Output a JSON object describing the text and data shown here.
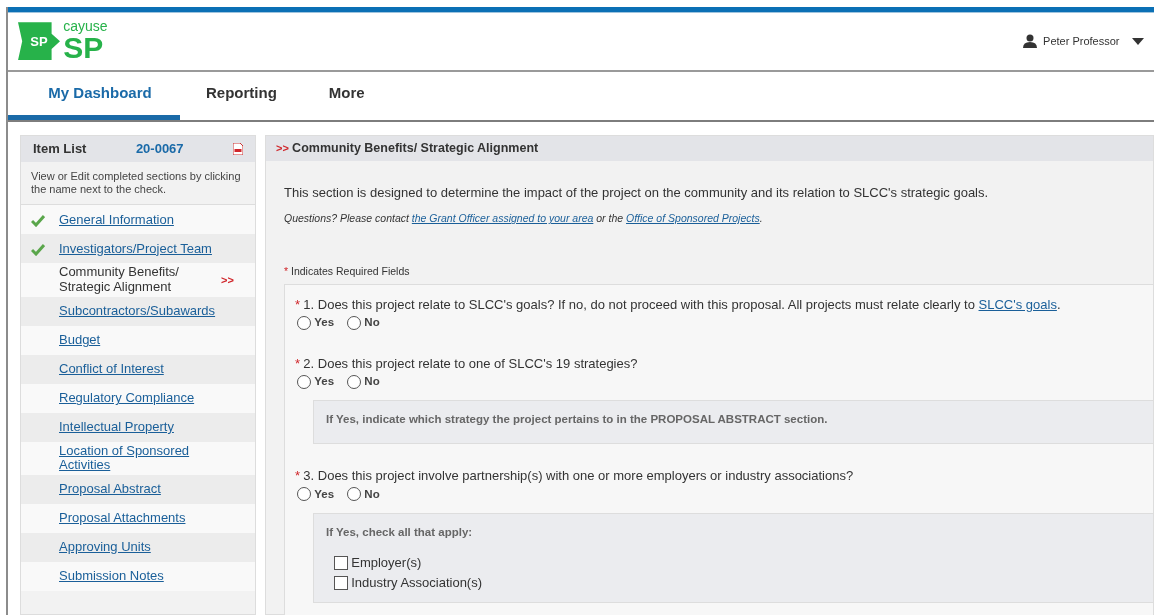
{
  "logo": {
    "small": "SP",
    "brand": "cayuse",
    "big": "SP"
  },
  "user": {
    "name": "Peter Professor"
  },
  "tabs": [
    {
      "label": "My Dashboard",
      "selected": true
    },
    {
      "label": "Reporting",
      "selected": false
    },
    {
      "label": "More",
      "selected": false
    }
  ],
  "sidebar": {
    "title": "Item List",
    "number": "20-0067",
    "hint": "View or Edit completed sections by clicking the name next to the check.",
    "items": [
      {
        "label": "General Information",
        "completed": true,
        "current": false
      },
      {
        "label": "Investigators/Project Team",
        "completed": true,
        "current": false
      },
      {
        "label": "Community Benefits/ Strategic Alignment",
        "completed": false,
        "current": true,
        "marker": ">>"
      },
      {
        "label": "Subcontractors/Subawards",
        "completed": false,
        "current": false
      },
      {
        "label": "Budget",
        "completed": false,
        "current": false
      },
      {
        "label": "Conflict of Interest",
        "completed": false,
        "current": false
      },
      {
        "label": "Regulatory Compliance",
        "completed": false,
        "current": false
      },
      {
        "label": "Intellectual Property",
        "completed": false,
        "current": false
      },
      {
        "label": "Location of Sponsored Activities",
        "completed": false,
        "current": false
      },
      {
        "label": "Proposal Abstract",
        "completed": false,
        "current": false
      },
      {
        "label": "Proposal Attachments",
        "completed": false,
        "current": false
      },
      {
        "label": "Approving Units",
        "completed": false,
        "current": false
      },
      {
        "label": "Submission Notes",
        "completed": false,
        "current": false
      }
    ]
  },
  "section": {
    "marker": ">>",
    "title": "Community Benefits/ Strategic Alignment",
    "intro": "This section is designed to determine the impact of the project on the community and its relation to SLCC's strategic goals.",
    "contact": [
      {
        "kind": "text",
        "text": "Questions? Please contact "
      },
      {
        "kind": "link",
        "text": "the Grant Officer assigned to your area"
      },
      {
        "kind": "text",
        "text": " or the "
      },
      {
        "kind": "link",
        "text": "Office of Sponsored Projects"
      },
      {
        "kind": "text",
        "text": "."
      }
    ],
    "required_mark": "*",
    "required_note": "Indicates Required Fields",
    "questions": [
      {
        "required_mark": "*",
        "parts": [
          {
            "kind": "text",
            "text": "1. Does this project relate to SLCC's goals? If no, do not proceed with this proposal. All projects must relate clearly to "
          },
          {
            "kind": "link",
            "text": "SLCC's goals"
          },
          {
            "kind": "text",
            "text": "."
          }
        ],
        "options": [
          {
            "label": "Yes",
            "selected": false
          },
          {
            "label": "No",
            "selected": false
          }
        ]
      },
      {
        "required_mark": "*",
        "parts": [
          {
            "kind": "text",
            "text": "2. Does this project relate to one of SLCC's 19 strategies?"
          }
        ],
        "options": [
          {
            "label": "Yes",
            "selected": false
          },
          {
            "label": "No",
            "selected": false
          }
        ],
        "note": "If Yes, indicate which strategy the project pertains to in the PROPOSAL ABSTRACT section."
      },
      {
        "required_mark": "*",
        "parts": [
          {
            "kind": "text",
            "text": "3. Does this project involve partnership(s) with one or more employers or industry associations?"
          }
        ],
        "options": [
          {
            "label": "Yes",
            "selected": false
          },
          {
            "label": "No",
            "selected": false
          }
        ],
        "note": "If Yes, check all that apply:",
        "checkboxes": [
          {
            "label": "Employer(s)",
            "checked": false
          },
          {
            "label": "Industry Association(s)",
            "checked": false
          }
        ]
      }
    ]
  }
}
